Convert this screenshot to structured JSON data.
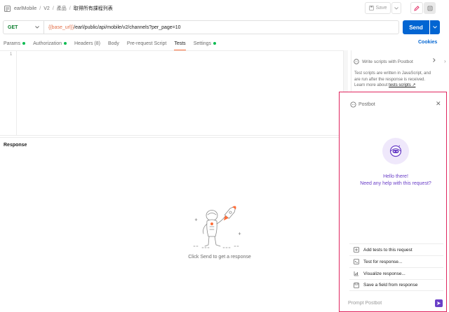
{
  "breadcrumb": {
    "items": [
      "earlMobile",
      "V2",
      "產品",
      "取得所有課程列表"
    ]
  },
  "toolbar": {
    "save_label": "Save"
  },
  "request": {
    "method": "GET",
    "url_variable": "{{base_url}}",
    "url_path": "/earl/public/api/mobile/v2/channels?per_page=10",
    "send_label": "Send"
  },
  "tabs": [
    {
      "label": "Params",
      "dot": true
    },
    {
      "label": "Authorization",
      "dot": true
    },
    {
      "label": "Headers (8)",
      "dot": false
    },
    {
      "label": "Body",
      "dot": false
    },
    {
      "label": "Pre-request Script",
      "dot": false
    },
    {
      "label": "Tests",
      "dot": false,
      "active": true
    },
    {
      "label": "Settings",
      "dot": true
    }
  ],
  "cookies_label": "Cookies",
  "editor": {
    "line_number": "1"
  },
  "snippets": {
    "title": "Write scripts with Postbot",
    "description": "Test scripts are written in JavaScript, and are run after the response is received. Learn more about ",
    "link_label": "tests scripts ↗"
  },
  "response": {
    "label": "Response",
    "empty_message": "Click Send to get a response"
  },
  "postbot": {
    "title": "Postbot",
    "greeting_line1": "Hello there!",
    "greeting_line2": "Need any help with this request?",
    "suggestions": [
      {
        "label": "Add tests to this request",
        "icon": "add-tests-icon"
      },
      {
        "label": "Test for response...",
        "icon": "terminal-icon"
      },
      {
        "label": "Visualize response...",
        "icon": "chart-icon"
      },
      {
        "label": "Save a field from response",
        "icon": "save-field-icon"
      }
    ],
    "prompt_placeholder": "Prompt Postbot"
  },
  "colors": {
    "accent_orange": "#ff6c37",
    "send_blue": "#0265d2",
    "postbot_purple": "#6a3fc7",
    "panel_highlight": "#e0245e",
    "method_green": "#0a7d2c",
    "status_dot_green": "#0cbb52"
  }
}
